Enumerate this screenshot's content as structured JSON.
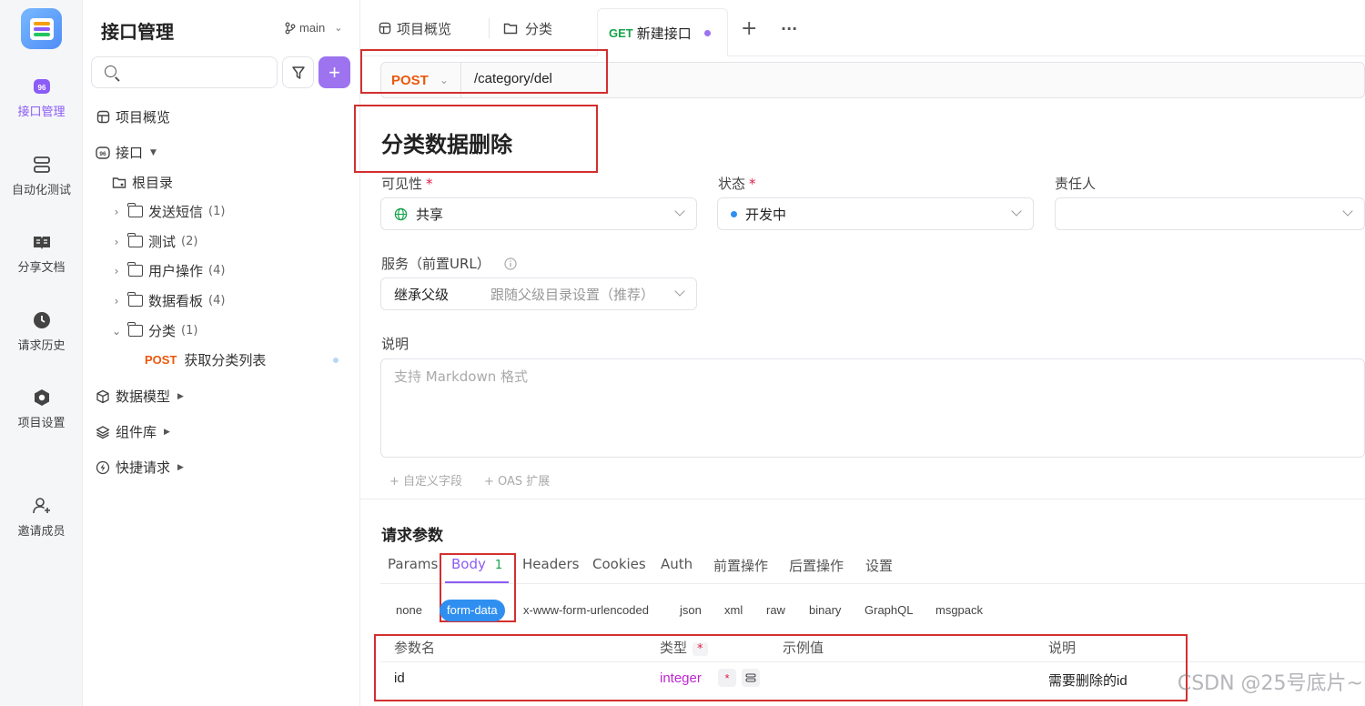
{
  "rail": {
    "items": [
      {
        "label": "接口管理",
        "icon": "api-management-icon",
        "active": true
      },
      {
        "label": "自动化测试",
        "icon": "automation-test-icon"
      },
      {
        "label": "分享文档",
        "icon": "share-doc-icon"
      },
      {
        "label": "请求历史",
        "icon": "history-clock-icon"
      },
      {
        "label": "项目设置",
        "icon": "settings-icon"
      },
      {
        "label": "邀请成员",
        "icon": "invite-member-icon"
      }
    ]
  },
  "sidebar": {
    "title": "接口管理",
    "branch": "main",
    "search": {
      "placeholder": ""
    },
    "overview": "项目概览",
    "api": "接口",
    "root": "根目录",
    "folders": [
      {
        "name": "发送短信",
        "count": "(1)"
      },
      {
        "name": "测试",
        "count": "(2)"
      },
      {
        "name": "用户操作",
        "count": "(4)"
      },
      {
        "name": "数据看板",
        "count": "(4)"
      },
      {
        "name": "分类",
        "count": "(1)"
      }
    ],
    "endpoint": {
      "method": "POST",
      "name": "获取分类列表"
    },
    "data_model": "数据模型",
    "components": "组件库",
    "quick_request": "快捷请求"
  },
  "tabs": {
    "overview": "项目概览",
    "category": "分类",
    "new_method": "GET",
    "new_api": "新建接口",
    "add": "+",
    "more": "···"
  },
  "request": {
    "method": "POST",
    "path": "/category/del"
  },
  "form": {
    "title": "分类数据删除",
    "visibility_label": "可见性",
    "visibility_value": "共享",
    "status_label": "状态",
    "status_value": "开发中",
    "owner_label": "责任人",
    "owner_value": "",
    "service_label": "服务（前置URL）",
    "service_value": "继承父级",
    "service_hint": "跟随父级目录设置（推荐）",
    "desc_label": "说明",
    "desc_placeholder": "支持 Markdown 格式",
    "custom_field": "+ 自定义字段",
    "oas_ext": "+ OAS 扩展",
    "required_mark": "*"
  },
  "params": {
    "title": "请求参数",
    "tabs": [
      "Params",
      "Body",
      "Headers",
      "Cookies",
      "Auth",
      "前置操作",
      "后置操作",
      "设置"
    ],
    "body_badge": "1",
    "body_types": [
      "none",
      "form-data",
      "x-www-form-urlencoded",
      "json",
      "xml",
      "raw",
      "binary",
      "GraphQL",
      "msgpack"
    ],
    "columns": [
      "参数名",
      "类型",
      "示例值",
      "说明"
    ],
    "rows": [
      {
        "name": "id",
        "type": "integer",
        "example": "",
        "desc": "需要删除的id"
      }
    ]
  },
  "watermark": "CSDN @25号底片~",
  "colors": {
    "accent": "#8b5cf6",
    "post": "#ea580c",
    "get": "#16a34a",
    "annotation": "#d32f2f",
    "active_pill": "#2f8ff0"
  }
}
